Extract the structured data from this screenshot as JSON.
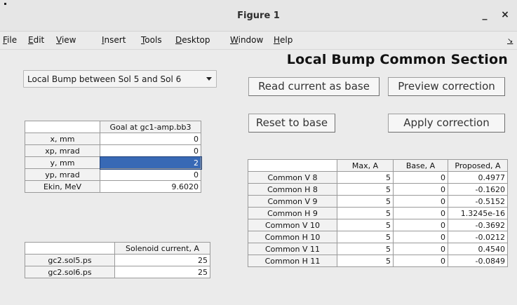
{
  "window": {
    "title": "Figure 1",
    "minimize_glyph": "_",
    "close_glyph": "×"
  },
  "menu": {
    "items": [
      "File",
      "Edit",
      "View",
      "Insert",
      "Tools",
      "Desktop",
      "Window",
      "Help"
    ],
    "overflow_glyph": "↘"
  },
  "section_title": "Local Bump Common Section",
  "section_select": {
    "value": "Local Bump between Sol 5 and Sol 6"
  },
  "buttons": {
    "read_current": "Read current as base",
    "preview": "Preview correction",
    "reset": "Reset to base",
    "apply": "Apply correction"
  },
  "goal_table": {
    "header": "Goal at gc1-amp.bb3",
    "rows": [
      {
        "label": "x, mm",
        "value": "0"
      },
      {
        "label": "xp, mrad",
        "value": "0"
      },
      {
        "label": "y, mm",
        "value": "2"
      },
      {
        "label": "yp, mrad",
        "value": "0"
      },
      {
        "label": "Ekin, MeV",
        "value": "9.6020"
      }
    ]
  },
  "solenoid_table": {
    "header": "Solenoid current, A",
    "rows": [
      {
        "label": "gc2.sol5.ps",
        "value": "25"
      },
      {
        "label": "gc2.sol6.ps",
        "value": "25"
      }
    ]
  },
  "corrector_table": {
    "headers": [
      "Max, A",
      "Base, A",
      "Proposed, A"
    ],
    "rows": [
      {
        "label": "Common V 8",
        "max": "5",
        "base": "0",
        "proposed": "0.4977"
      },
      {
        "label": "Common H 8",
        "max": "5",
        "base": "0",
        "proposed": "-0.1620"
      },
      {
        "label": "Common V 9",
        "max": "5",
        "base": "0",
        "proposed": "-0.5152"
      },
      {
        "label": "Common H 9",
        "max": "5",
        "base": "0",
        "proposed": "1.3245e-16"
      },
      {
        "label": "Common V 10",
        "max": "5",
        "base": "0",
        "proposed": "-0.3692"
      },
      {
        "label": "Common H 10",
        "max": "5",
        "base": "0",
        "proposed": "-0.0212"
      },
      {
        "label": "Common V 11",
        "max": "5",
        "base": "0",
        "proposed": "0.4540"
      },
      {
        "label": "Common H 11",
        "max": "5",
        "base": "0",
        "proposed": "-0.0849"
      }
    ]
  },
  "colors": {
    "selection": "#3869b5",
    "window_bg": "#ebebeb"
  }
}
